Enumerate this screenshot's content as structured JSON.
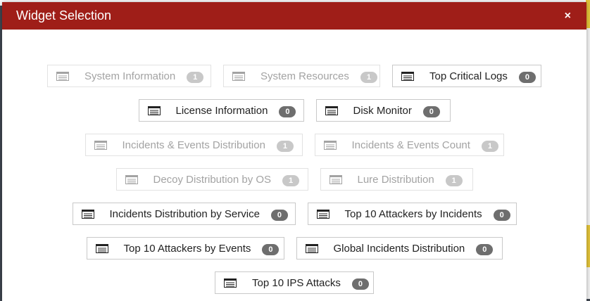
{
  "modal": {
    "title": "Widget Selection",
    "close_label": "×"
  },
  "widgets": [
    {
      "label": "System Information",
      "count": "1"
    },
    {
      "label": "System Resources",
      "count": "1"
    },
    {
      "label": "Top Critical Logs",
      "count": "0"
    },
    {
      "label": "License Information",
      "count": "0"
    },
    {
      "label": "Disk Monitor",
      "count": "0"
    },
    {
      "label": "Incidents & Events Distribution",
      "count": "1"
    },
    {
      "label": "Incidents & Events Count",
      "count": "1"
    },
    {
      "label": "Decoy Distribution by OS",
      "count": "1"
    },
    {
      "label": "Lure Distribution",
      "count": "1"
    },
    {
      "label": "Incidents Distribution by Service",
      "count": "0"
    },
    {
      "label": "Top 10 Attackers by Incidents",
      "count": "0"
    },
    {
      "label": "Top 10 Attackers by Events",
      "count": "0"
    },
    {
      "label": "Global Incidents Distribution",
      "count": "0"
    },
    {
      "label": "Top 10 IPS Attacks",
      "count": "0"
    }
  ],
  "icons": {
    "widget": "widget-list-icon",
    "close": "close-icon"
  },
  "colors": {
    "header": "#9f1e18",
    "badge_active": "#6e6e6e",
    "badge_disabled": "#c8c8c8"
  }
}
